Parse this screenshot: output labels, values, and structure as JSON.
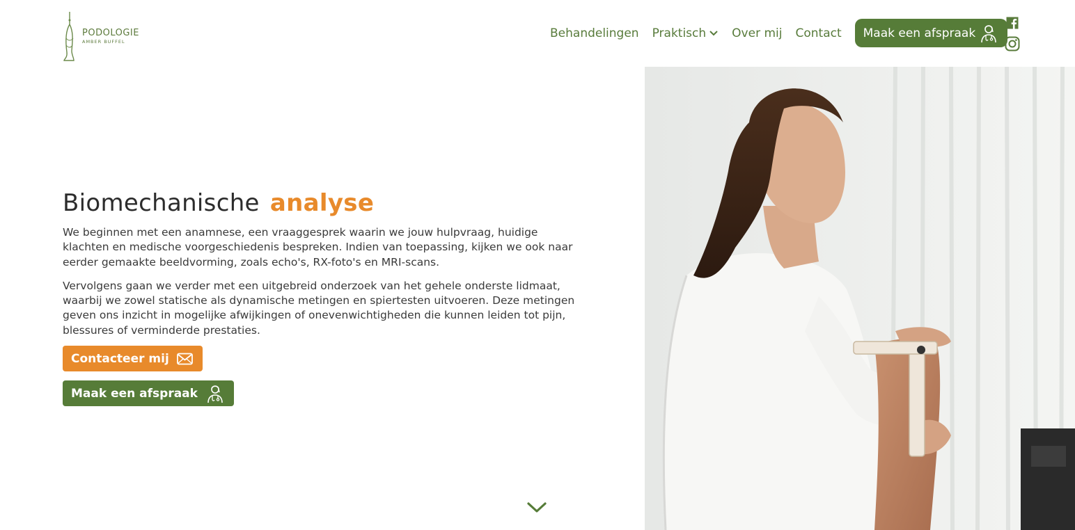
{
  "logo": {
    "title": "PODOLOGIE",
    "subtitle": "AMBER BUFFEL"
  },
  "nav": {
    "items": [
      {
        "label": "Behandelingen"
      },
      {
        "label": "Praktisch"
      },
      {
        "label": "Over mij"
      },
      {
        "label": "Contact"
      }
    ],
    "cta_label": "Maak een afspraak"
  },
  "socials": [
    "facebook-icon",
    "instagram-icon"
  ],
  "main": {
    "heading_plain": "Biomechanische",
    "heading_accent": "analyse",
    "paragraphs": [
      "We beginnen met een anamnese, een vraaggesprek waarin we jouw hulpvraag, huidige klachten en medische voorgeschiedenis bespreken. Indien van toepassing, kijken we ook naar eerder gemaakte beeldvorming, zoals echo's, RX-foto's en MRI-scans.",
      "Vervolgens gaan we verder met een uitgebreid onderzoek van het gehele onderste lidmaat, waarbij we zowel statische als dynamische metingen en spiertesten uitvoeren. Deze metingen geven ons inzicht in mogelijke afwijkingen of onevenwichtigheden die kunnen leiden tot pijn, blessures of verminderde prestaties."
    ],
    "contact_button": "Contacteer mij",
    "appointment_button": "Maak een afspraak"
  },
  "colors": {
    "brand_green": "#567c38",
    "accent_orange": "#e88a2b",
    "nav_text": "#587b3b"
  },
  "icons": {
    "contact": "envelope-icon",
    "appointment": "doctor-icon",
    "scroll": "chevron-down-icon"
  }
}
